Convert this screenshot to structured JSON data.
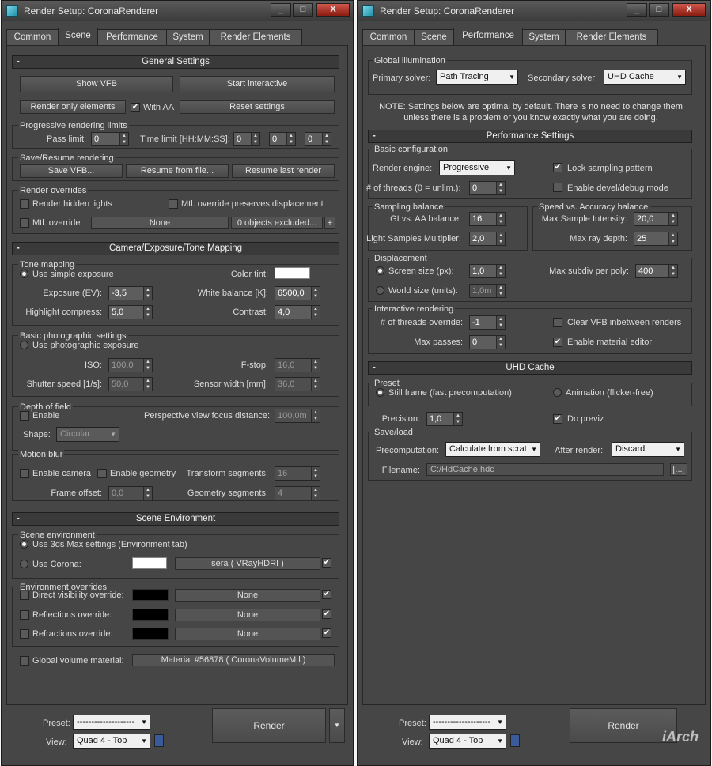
{
  "left": {
    "title": "Render Setup: CoronaRenderer",
    "window_buttons": [
      "_",
      "□",
      "X"
    ],
    "tabs": [
      "Common",
      "Scene",
      "Performance",
      "System",
      "Render Elements"
    ],
    "general": {
      "header": "General Settings",
      "show_vfb": "Show VFB",
      "start_interactive": "Start interactive",
      "render_only_elements": "Render only elements",
      "with_aa": "With AA",
      "reset_settings": "Reset settings",
      "prog_limits": "Progressive rendering limits",
      "pass_limit": "Pass limit:",
      "pass_value": "0",
      "time_limit": "Time limit [HH:MM:SS]:",
      "time_h": "0",
      "time_m": "0",
      "time_s": "0",
      "save_resume": "Save/Resume rendering",
      "save_vfb": "Save VFB...",
      "resume_file": "Resume from file...",
      "resume_last": "Resume last render",
      "overrides": "Render overrides",
      "hidden_lights": "Render hidden lights",
      "preserve_disp": "Mtl. override preserves displacement",
      "mtl_override": "Mtl. override:",
      "mtl_none": "None",
      "excluded": "0 objects excluded...",
      "plus": "+"
    },
    "camera": {
      "header": "Camera/Exposure/Tone Mapping",
      "tone_mapping": "Tone mapping",
      "use_simple": "Use simple exposure",
      "color_tint": "Color tint:",
      "exposure": "Exposure (EV):",
      "exposure_val": "-3,5",
      "white_balance": "White balance [K]:",
      "wb_val": "6500,0",
      "highlight": "Highlight compress:",
      "highlight_val": "5,0",
      "contrast": "Contrast:",
      "contrast_val": "4,0",
      "basic_photo": "Basic photographic settings",
      "use_photo": "Use photographic exposure",
      "iso": "ISO:",
      "iso_val": "100,0",
      "fstop": "F-stop:",
      "fstop_val": "16,0",
      "shutter": "Shutter speed [1/s]:",
      "shutter_val": "50,0",
      "sensor": "Sensor width [mm]:",
      "sensor_val": "36,0",
      "dof": "Depth of field",
      "enable": "Enable",
      "persp_focus": "Perspective view focus distance:",
      "focus_val": "100,0m",
      "shape": "Shape:",
      "shape_val": "Circular",
      "motion_blur": "Motion blur",
      "enable_camera": "Enable camera",
      "enable_geometry": "Enable geometry",
      "transform_seg": "Transform segments:",
      "transform_val": "16",
      "frame_offset": "Frame offset:",
      "frame_val": "0,0",
      "geometry_seg": "Geometry segments:",
      "geometry_val": "4"
    },
    "scene_env": {
      "header": "Scene Environment",
      "scene_environment": "Scene environment",
      "use_3ds": "Use 3ds Max settings (Environment tab)",
      "use_corona": "Use Corona:",
      "corona_map": "sera  ( VRayHDRI )",
      "env_overrides": "Environment overrides",
      "direct_vis": "Direct visibility override:",
      "reflections": "Reflections override:",
      "refractions": "Refractions override:",
      "none": "None",
      "global_volume": "Global volume material:",
      "volume_mtl": "Material #56878  ( CoronaVolumeMtl )"
    },
    "footer": {
      "preset": "Preset:",
      "preset_val": "--------------------",
      "view": "View:",
      "view_val": "Quad 4 - Top",
      "render": "Render"
    }
  },
  "right": {
    "title": "Render Setup: CoronaRenderer",
    "window_buttons": [
      "_",
      "□",
      "X"
    ],
    "tabs": [
      "Common",
      "Scene",
      "Performance",
      "System",
      "Render Elements"
    ],
    "gi": {
      "group": "Global illumination",
      "primary": "Primary solver:",
      "primary_val": "Path Tracing",
      "secondary": "Secondary solver:",
      "secondary_val": "UHD Cache",
      "note": "NOTE: Settings below are optimal by default. There is no need to change them unless there is a problem or you know exactly what you are doing."
    },
    "perf": {
      "header": "Performance Settings",
      "basic_config": "Basic configuration",
      "render_engine": "Render engine:",
      "engine_val": "Progressive",
      "lock_sampling": "Lock sampling pattern",
      "threads": "# of threads (0 = unlim.):",
      "threads_val": "0",
      "devel_debug": "Enable devel/debug mode",
      "sampling_balance": "Sampling balance",
      "gi_aa": "GI vs. AA balance:",
      "gi_aa_val": "16",
      "light_samples": "Light Samples Multiplier:",
      "light_val": "2,0",
      "speed_accuracy": "Speed vs. Accuracy balance",
      "max_intensity": "Max Sample Intensity:",
      "max_int_val": "20,0",
      "max_ray": "Max ray depth:",
      "max_ray_val": "25",
      "displacement": "Displacement",
      "screen_size": "Screen size (px):",
      "screen_val": "1,0",
      "max_subdiv": "Max subdiv per poly:",
      "subdiv_val": "400",
      "world_size": "World size (units):",
      "world_val": "1,0m",
      "interactive": "Interactive rendering",
      "threads_override": "# of threads override:",
      "override_val": "-1",
      "clear_vfb": "Clear VFB inbetween renders",
      "max_passes": "Max passes:",
      "passes_val": "0",
      "mat_editor": "Enable material editor"
    },
    "uhd": {
      "header": "UHD Cache",
      "preset": "Preset",
      "still": "Still frame (fast precomputation)",
      "animation": "Animation (flicker-free)",
      "precision": "Precision:",
      "precision_val": "1,0",
      "do_previz": "Do previz",
      "save_load": "Save/load",
      "precomp": "Precomputation:",
      "precomp_val": "Calculate from scrat",
      "after_render": "After render:",
      "after_val": "Discard",
      "filename": "Filename:",
      "filename_val": "C:/HdCache.hdc",
      "browse": "[...]"
    },
    "footer": {
      "preset": "Preset:",
      "preset_val": "--------------------",
      "view": "View:",
      "view_val": "Quad 4 - Top",
      "render": "Render"
    }
  },
  "watermark": "iArch"
}
